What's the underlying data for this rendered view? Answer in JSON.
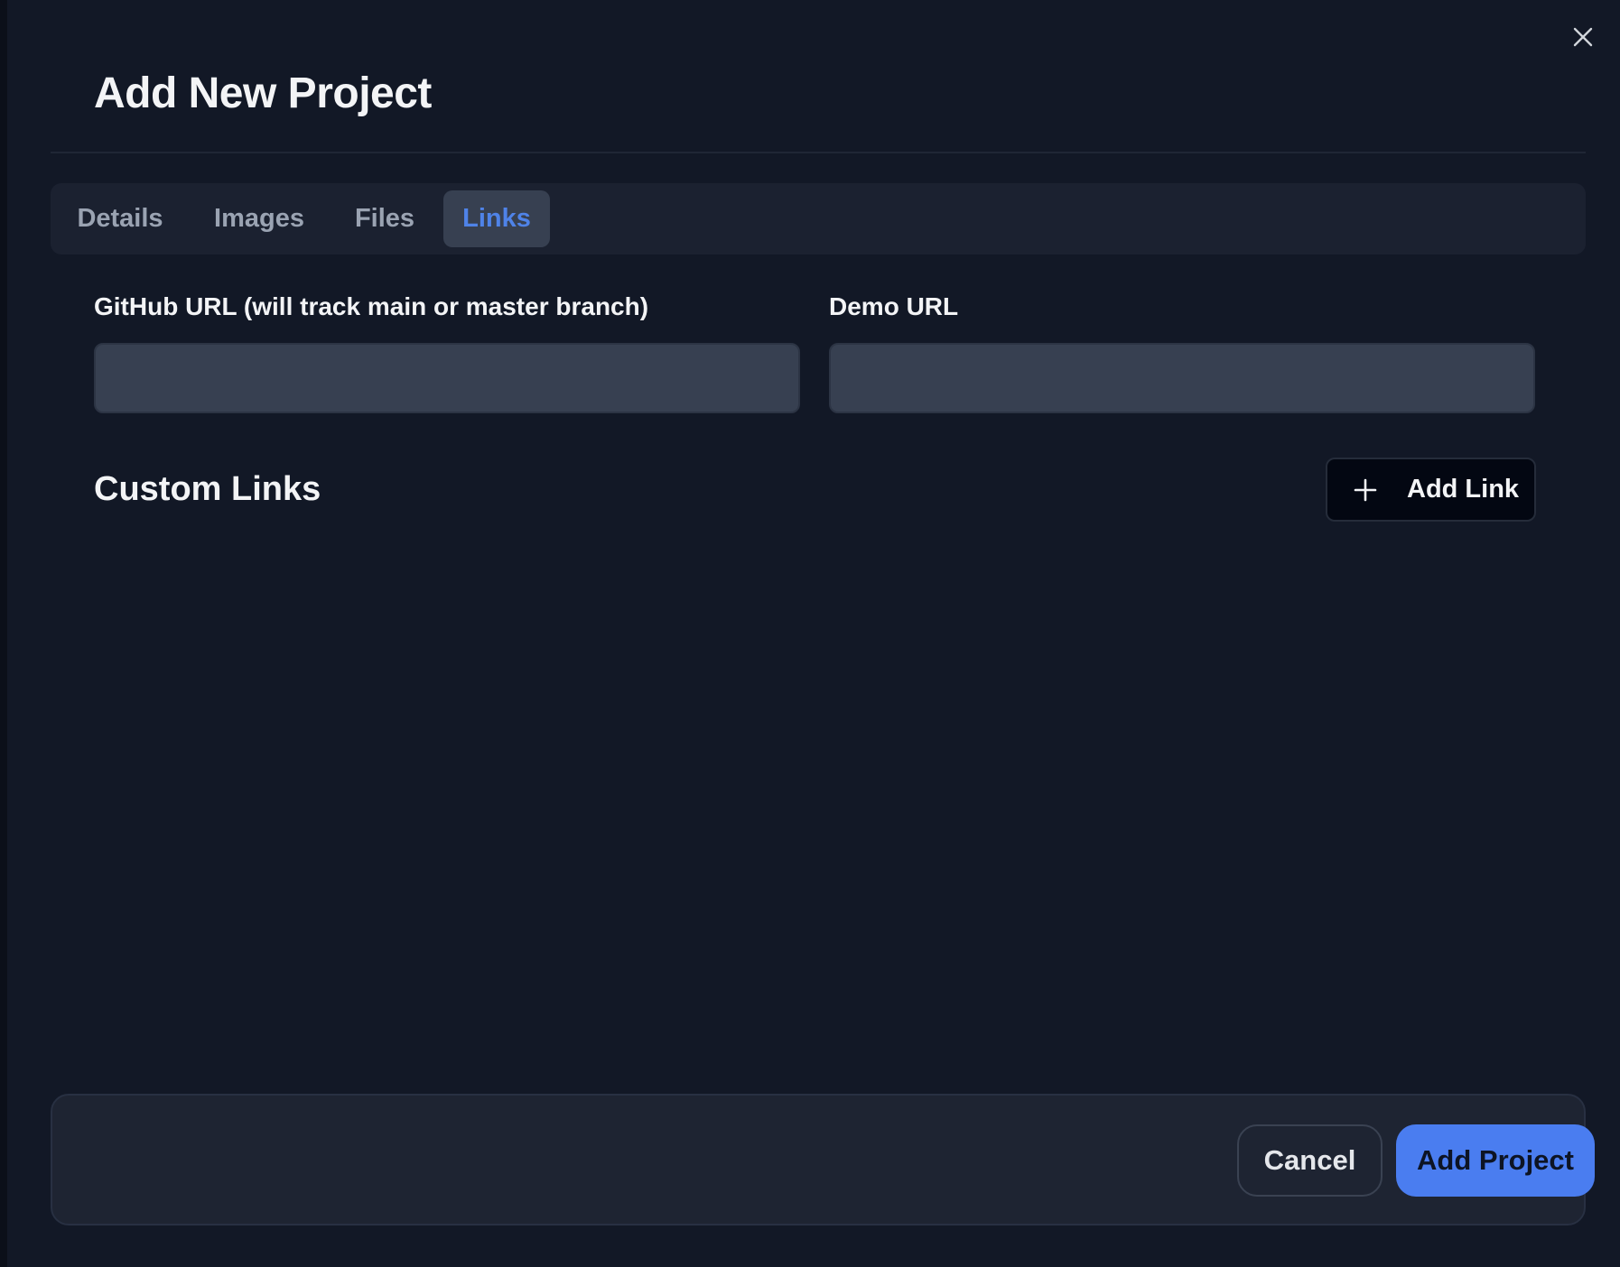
{
  "modal": {
    "title": "Add New Project",
    "close_icon": "close-icon"
  },
  "tabs": [
    {
      "label": "Details",
      "active": false
    },
    {
      "label": "Images",
      "active": false
    },
    {
      "label": "Files",
      "active": false
    },
    {
      "label": "Links",
      "active": true
    }
  ],
  "fields": {
    "github_label": "GitHub URL (will track main or master branch)",
    "github_value": "",
    "demo_label": "Demo URL",
    "demo_value": ""
  },
  "custom_links": {
    "title": "Custom Links",
    "add_button_label": "Add Link",
    "add_button_icon": "plus-icon",
    "items": []
  },
  "footer": {
    "cancel_label": "Cancel",
    "submit_label": "Add Project"
  },
  "colors": {
    "modal_background": "#121826",
    "active_tab_text": "#4f83e8",
    "primary_button": "#4a7df0"
  }
}
